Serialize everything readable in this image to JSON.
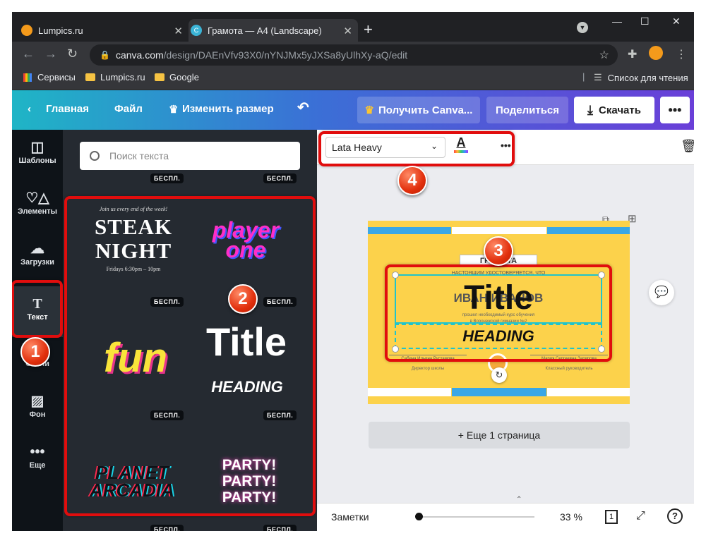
{
  "browser": {
    "tabs": [
      {
        "title": "Lumpics.ru"
      },
      {
        "title": "Грамота — A4 (Landscape)"
      }
    ],
    "url_host": "canva.com",
    "url_path": "/design/DAEnVfv93X0/nYNJMx5yJXSa8yUlhXy-aQ/edit",
    "bookmarks": [
      "Сервисы",
      "Lumpics.ru",
      "Google"
    ],
    "reading_list": "Список для чтения"
  },
  "header": {
    "home": "Главная",
    "file": "Файл",
    "resize": "Изменить размер",
    "get_canva": "Получить Canva...",
    "share": "Поделиться",
    "download": "Скачать"
  },
  "rail": {
    "items": [
      {
        "label": "Шаблоны"
      },
      {
        "label": "Элементы"
      },
      {
        "label": "Загрузки"
      },
      {
        "label": "Текст"
      },
      {
        "label": "Стили"
      },
      {
        "label": "Фон"
      },
      {
        "label": "Еще"
      }
    ]
  },
  "panel": {
    "search_placeholder": "Поиск текста",
    "badge": "БЕСПЛ.",
    "samples": {
      "steak_small": "Join us every end of the week!",
      "steak_main": "STEAK\nNIGHT",
      "steak_time": "Fridays 6:30pm – 10pm",
      "player": "player\none",
      "fun": "fun",
      "title": "Title",
      "heading": "HEADING",
      "planet": "PLANET\nARCADIA",
      "party": "PARTY!\nPARTY!\nPARTY!"
    }
  },
  "editor": {
    "font": "Lata Heavy",
    "canvas_title": "Title",
    "canvas_heading": "HEADING",
    "doc_ribbon": "ГРАМОТА",
    "doc_line1": "НАСТОЯЩИМ УДОСТОВЕРЯЕТСЯ, ЧТО",
    "doc_name": "ИВАН ИВАНОВ",
    "doc_line2": "прошел необходимый курс обучения",
    "doc_line3": "в Воронежской гимназии №2",
    "doc_sig1": "Сабина Ильина Рустамова",
    "doc_sig1_role": "Директор школы",
    "doc_sig2": "Мария Сергеевна Зарипова",
    "doc_sig2_role": "Классный руководитель",
    "add_page": "+ Еще 1 страница",
    "notes": "Заметки",
    "zoom": "33 %",
    "page_num": "1",
    "zoom_fraction": 0.33
  },
  "annotations": [
    "1",
    "2",
    "3",
    "4"
  ],
  "colors": {
    "highlight": "#e10d0d",
    "doc_bg": "#fcd24b",
    "doc_accent": "#3aa7e6"
  }
}
